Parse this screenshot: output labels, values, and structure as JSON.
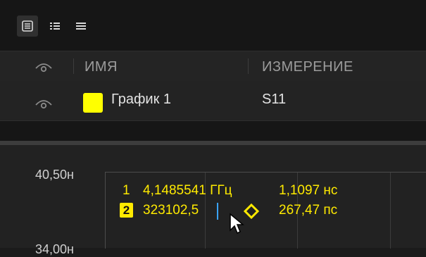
{
  "toolbar": {
    "views": [
      {
        "icon": "list-boxed-icon",
        "active": true
      },
      {
        "icon": "two-column-list-icon",
        "active": false
      },
      {
        "icon": "lines-list-icon",
        "active": false
      }
    ]
  },
  "table": {
    "headers": {
      "visibility_icon": "eye-icon",
      "name": "ИМЯ",
      "measurement": "ИЗМЕРЕНИЕ"
    },
    "rows": [
      {
        "visibility_icon": "eye-icon",
        "color": "#ffff00",
        "name": "График 1",
        "measurement": "S11"
      }
    ]
  },
  "chart": {
    "y_ticks": [
      "40,50н",
      "34,00н"
    ],
    "markers": {
      "m1_index": "1",
      "m1_freq": "4,1485541 ГГц",
      "m1_value": "1,1097 нс",
      "m2_index": "2",
      "m2_freq_input": "323102,5",
      "m2_value": "267,47 пс"
    }
  }
}
